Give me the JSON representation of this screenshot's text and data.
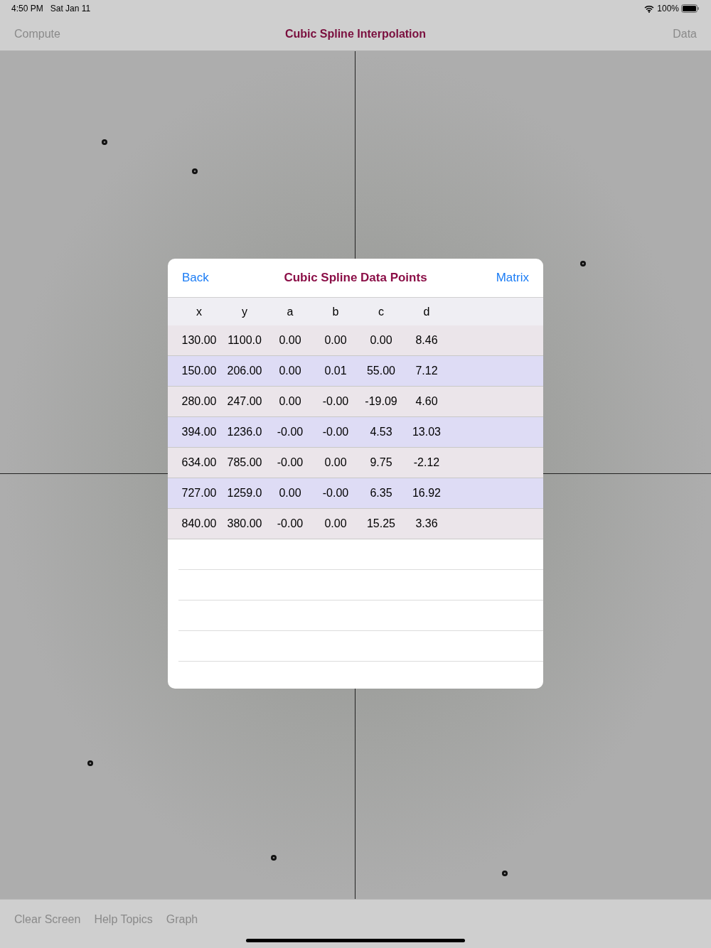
{
  "status_bar": {
    "time": "4:50 PM",
    "date": "Sat Jan 11",
    "battery": "100%"
  },
  "nav_bar": {
    "left": "Compute",
    "title": "Cubic Spline Interpolation",
    "right": "Data"
  },
  "dialog": {
    "back": "Back",
    "title": "Cubic Spline Data Points",
    "right": "Matrix",
    "columns": [
      "x",
      "y",
      "a",
      "b",
      "c",
      "d"
    ],
    "rows": [
      [
        "130.00",
        "1100.0",
        "0.00",
        "0.00",
        "0.00",
        "8.46"
      ],
      [
        "150.00",
        "206.00",
        "0.00",
        "0.01",
        "55.00",
        "7.12"
      ],
      [
        "280.00",
        "247.00",
        "0.00",
        "-0.00",
        "-19.09",
        "4.60"
      ],
      [
        "394.00",
        "1236.0",
        "-0.00",
        "-0.00",
        "4.53",
        "13.03"
      ],
      [
        "634.00",
        "785.00",
        "-0.00",
        "0.00",
        "9.75",
        "-2.12"
      ],
      [
        "727.00",
        "1259.0",
        "0.00",
        "-0.00",
        "6.35",
        "16.92"
      ],
      [
        "840.00",
        "380.00",
        "-0.00",
        "0.00",
        "15.25",
        "3.36"
      ]
    ]
  },
  "toolbar": [
    "Clear Screen",
    "Help Topics",
    "Graph"
  ]
}
